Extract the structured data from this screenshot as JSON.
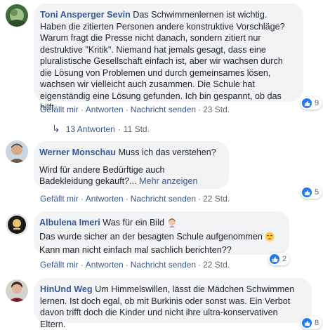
{
  "comments": [
    {
      "author": "Toni Ansperger Sevin",
      "text": "Das Schwimmenlernen ist wichtig. Haben die zitierten Personen andere konstruktive Vorschläge? Warum fragt die Presse nicht danach, sondern zitiert nur destruktive \"Kritik\". Niemand hat jemals gesagt, dass eine pluralistische Gesellschaft einfach ist, aber wir wachsen durch die Lösung von Problemen und durch gemeinsames lösen, wachsen wir vielleicht auch zusammen. Die Schule hat eigenständig eine Lösung gefunden. Ich bin gespannt, ob das hilft.",
      "like": "Gefällt mir",
      "reply": "Antworten",
      "message": "Nachricht senden",
      "time": "23 Std.",
      "reactions": "9",
      "replies_label": "13 Antworten",
      "replies_time": "11 Std."
    },
    {
      "author": "Werner Monschau",
      "text1": "Muss ich das verstehen?",
      "text2": "Wird für andere Bedürftige auch Badekleidung gekauft?...",
      "more": "Mehr anzeigen",
      "like": "Gefällt mir",
      "reply": "Antworten",
      "message": "Nachricht senden",
      "time": "22 Std.",
      "reactions": "5"
    },
    {
      "author": "Albulena Imeri",
      "text1": "Was für ein Bild",
      "text2": "Das wurde sicher an der besagten Schule aufgenommen",
      "text3": "Kann man nicht einfach mal sachlich berichten??",
      "like": "Gefällt mir",
      "reply": "Antworten",
      "message": "Nachricht senden",
      "time": "22 Std.",
      "reactions": "2"
    },
    {
      "author": "HinUnd Weg",
      "text": "Um Himmelswillen, lässt die Mädchen Schwimmen lernen. Ist doch egal, ob mit Burkinis oder sonst was. Ein Verbot davon trifft doch die Kinder und nicht ihre ultra-konservativen Eltern.",
      "reactions": "8"
    }
  ],
  "separator": "·",
  "icons": {
    "like": "thumbs-up-icon",
    "reply_arrow": "reply-arrow-icon",
    "woman_emoji": "woman-facepalm-emoji-icon",
    "unamused_emoji": "unamused-face-emoji-icon"
  },
  "colors": {
    "link": "#385898",
    "bubble": "#f2f3f5",
    "meta": "#606770",
    "like_blue": "#2078f4"
  }
}
